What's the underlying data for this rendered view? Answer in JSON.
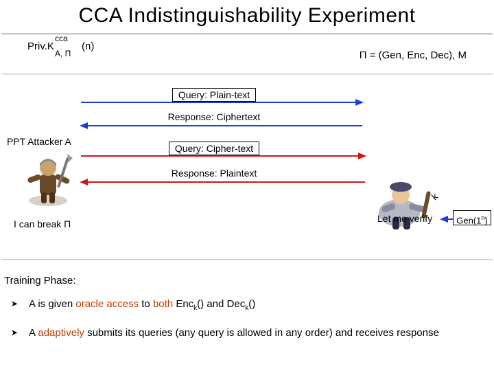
{
  "title": "CCA Indistinguishability Experiment",
  "privk": {
    "base": "Priv.K",
    "sup": "cca",
    "sub": "A, Π",
    "arg": "(n)"
  },
  "scheme_def": "Π = (Gen, Enc, Dec), M",
  "attacker_label": "PPT Attacker A",
  "break_text": "I can break Π",
  "verify_text": "Let me verify",
  "k_label": "k",
  "gen_label_prefix": "Gen(1",
  "gen_label_sup": "n",
  "gen_label_suffix": ")",
  "messages": {
    "q1": "Query: Plain-text",
    "r1": "Response: Ciphertext",
    "q2": "Query: Cipher-text",
    "r2": "Response: Plaintext"
  },
  "training_title": "Training Phase:",
  "bullet1_pre": "A is given ",
  "bullet1_hl": "oracle access",
  "bullet1_mid": " to ",
  "bullet1_hl2": "both",
  "bullet1_post_a": " Enc",
  "bullet1_sub": "k",
  "bullet1_post_b": "() and Dec",
  "bullet1_post_c": "()",
  "bullet2_pre": "A ",
  "bullet2_hl": "adaptively",
  "bullet2_post": " submits its queries (any query is allowed in any order) and receives  response"
}
